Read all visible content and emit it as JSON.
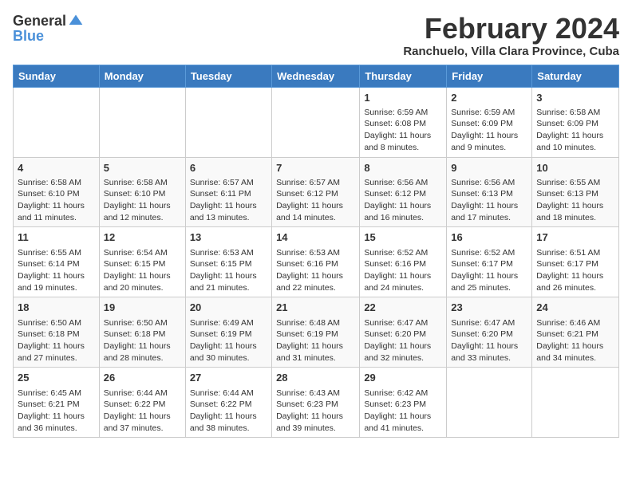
{
  "header": {
    "logo_general": "General",
    "logo_blue": "Blue",
    "title": "February 2024",
    "subtitle": "Ranchuelo, Villa Clara Province, Cuba"
  },
  "weekdays": [
    "Sunday",
    "Monday",
    "Tuesday",
    "Wednesday",
    "Thursday",
    "Friday",
    "Saturday"
  ],
  "weeks": [
    [
      {
        "day": "",
        "info": ""
      },
      {
        "day": "",
        "info": ""
      },
      {
        "day": "",
        "info": ""
      },
      {
        "day": "",
        "info": ""
      },
      {
        "day": "1",
        "info": "Sunrise: 6:59 AM\nSunset: 6:08 PM\nDaylight: 11 hours and 8 minutes."
      },
      {
        "day": "2",
        "info": "Sunrise: 6:59 AM\nSunset: 6:09 PM\nDaylight: 11 hours and 9 minutes."
      },
      {
        "day": "3",
        "info": "Sunrise: 6:58 AM\nSunset: 6:09 PM\nDaylight: 11 hours and 10 minutes."
      }
    ],
    [
      {
        "day": "4",
        "info": "Sunrise: 6:58 AM\nSunset: 6:10 PM\nDaylight: 11 hours and 11 minutes."
      },
      {
        "day": "5",
        "info": "Sunrise: 6:58 AM\nSunset: 6:10 PM\nDaylight: 11 hours and 12 minutes."
      },
      {
        "day": "6",
        "info": "Sunrise: 6:57 AM\nSunset: 6:11 PM\nDaylight: 11 hours and 13 minutes."
      },
      {
        "day": "7",
        "info": "Sunrise: 6:57 AM\nSunset: 6:12 PM\nDaylight: 11 hours and 14 minutes."
      },
      {
        "day": "8",
        "info": "Sunrise: 6:56 AM\nSunset: 6:12 PM\nDaylight: 11 hours and 16 minutes."
      },
      {
        "day": "9",
        "info": "Sunrise: 6:56 AM\nSunset: 6:13 PM\nDaylight: 11 hours and 17 minutes."
      },
      {
        "day": "10",
        "info": "Sunrise: 6:55 AM\nSunset: 6:13 PM\nDaylight: 11 hours and 18 minutes."
      }
    ],
    [
      {
        "day": "11",
        "info": "Sunrise: 6:55 AM\nSunset: 6:14 PM\nDaylight: 11 hours and 19 minutes."
      },
      {
        "day": "12",
        "info": "Sunrise: 6:54 AM\nSunset: 6:15 PM\nDaylight: 11 hours and 20 minutes."
      },
      {
        "day": "13",
        "info": "Sunrise: 6:53 AM\nSunset: 6:15 PM\nDaylight: 11 hours and 21 minutes."
      },
      {
        "day": "14",
        "info": "Sunrise: 6:53 AM\nSunset: 6:16 PM\nDaylight: 11 hours and 22 minutes."
      },
      {
        "day": "15",
        "info": "Sunrise: 6:52 AM\nSunset: 6:16 PM\nDaylight: 11 hours and 24 minutes."
      },
      {
        "day": "16",
        "info": "Sunrise: 6:52 AM\nSunset: 6:17 PM\nDaylight: 11 hours and 25 minutes."
      },
      {
        "day": "17",
        "info": "Sunrise: 6:51 AM\nSunset: 6:17 PM\nDaylight: 11 hours and 26 minutes."
      }
    ],
    [
      {
        "day": "18",
        "info": "Sunrise: 6:50 AM\nSunset: 6:18 PM\nDaylight: 11 hours and 27 minutes."
      },
      {
        "day": "19",
        "info": "Sunrise: 6:50 AM\nSunset: 6:18 PM\nDaylight: 11 hours and 28 minutes."
      },
      {
        "day": "20",
        "info": "Sunrise: 6:49 AM\nSunset: 6:19 PM\nDaylight: 11 hours and 30 minutes."
      },
      {
        "day": "21",
        "info": "Sunrise: 6:48 AM\nSunset: 6:19 PM\nDaylight: 11 hours and 31 minutes."
      },
      {
        "day": "22",
        "info": "Sunrise: 6:47 AM\nSunset: 6:20 PM\nDaylight: 11 hours and 32 minutes."
      },
      {
        "day": "23",
        "info": "Sunrise: 6:47 AM\nSunset: 6:20 PM\nDaylight: 11 hours and 33 minutes."
      },
      {
        "day": "24",
        "info": "Sunrise: 6:46 AM\nSunset: 6:21 PM\nDaylight: 11 hours and 34 minutes."
      }
    ],
    [
      {
        "day": "25",
        "info": "Sunrise: 6:45 AM\nSunset: 6:21 PM\nDaylight: 11 hours and 36 minutes."
      },
      {
        "day": "26",
        "info": "Sunrise: 6:44 AM\nSunset: 6:22 PM\nDaylight: 11 hours and 37 minutes."
      },
      {
        "day": "27",
        "info": "Sunrise: 6:44 AM\nSunset: 6:22 PM\nDaylight: 11 hours and 38 minutes."
      },
      {
        "day": "28",
        "info": "Sunrise: 6:43 AM\nSunset: 6:23 PM\nDaylight: 11 hours and 39 minutes."
      },
      {
        "day": "29",
        "info": "Sunrise: 6:42 AM\nSunset: 6:23 PM\nDaylight: 11 hours and 41 minutes."
      },
      {
        "day": "",
        "info": ""
      },
      {
        "day": "",
        "info": ""
      }
    ]
  ]
}
